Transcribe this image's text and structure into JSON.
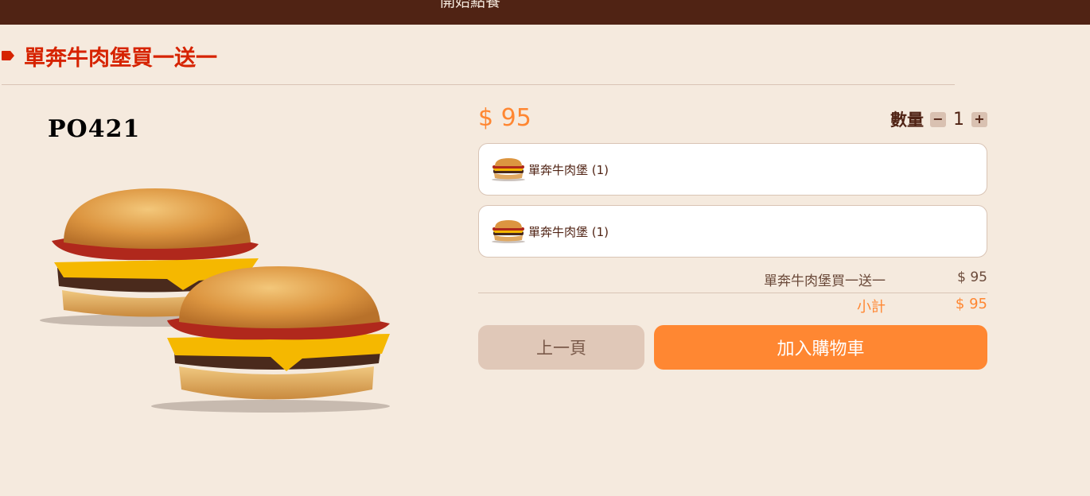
{
  "header": {
    "label": "開始點餐"
  },
  "title": "單奔牛肉堡買一送一",
  "product": {
    "code": "PO421"
  },
  "price": "$ 95",
  "quantity": {
    "label": "數量",
    "minus": "−",
    "value": "1",
    "plus": "+"
  },
  "items": [
    {
      "name": "單奔牛肉堡 (1)"
    },
    {
      "name": "單奔牛肉堡 (1)"
    }
  ],
  "summary": {
    "line_label": "單奔牛肉堡買一送一",
    "line_value": "$ 95",
    "subtotal_label": "小計",
    "subtotal_value": "$ 95"
  },
  "buttons": {
    "prev": "上一頁",
    "add_to_cart": "加入購物車"
  },
  "colors": {
    "brown": "#502314",
    "orange": "#ff8732",
    "red": "#d62300",
    "bg": "#f5eade"
  }
}
